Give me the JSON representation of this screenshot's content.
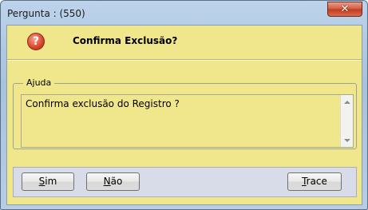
{
  "window": {
    "title": "Pergunta : (550)",
    "close_glyph": "✕"
  },
  "header": {
    "icon": "question-icon",
    "icon_glyph": "?",
    "title": "Confirma Exclusão?"
  },
  "help": {
    "legend": "Ajuda",
    "text": "Confirma exclusão do Registro ?"
  },
  "buttons": {
    "sim": {
      "accel": "S",
      "rest": "im"
    },
    "nao": {
      "accel": "N",
      "rest": "ão"
    },
    "trace": {
      "accel": "T",
      "rest": "race"
    }
  },
  "colors": {
    "client_bg": "#f0e68c",
    "button_panel_bg": "#d8dce8",
    "close_button": "#c8442a"
  }
}
